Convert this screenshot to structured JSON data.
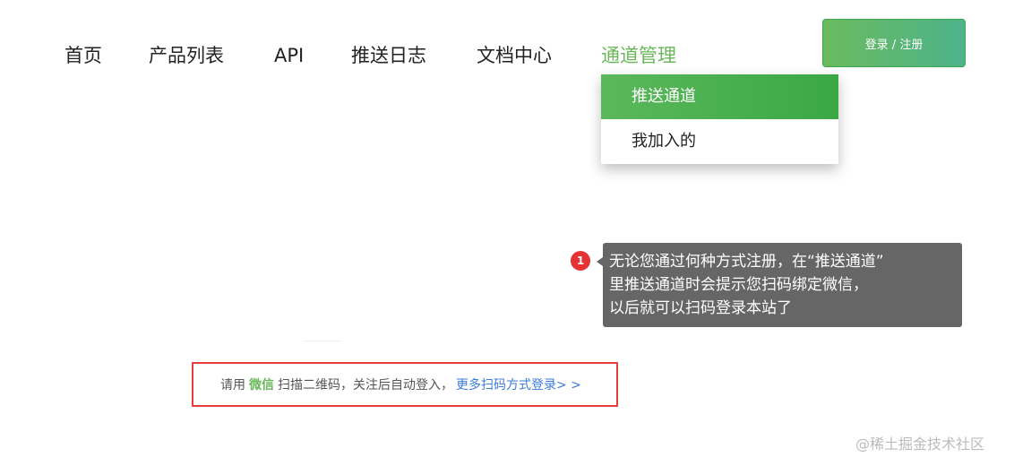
{
  "nav": {
    "items": [
      {
        "label": "首页"
      },
      {
        "label": "产品列表"
      },
      {
        "label": "API"
      },
      {
        "label": "推送日志"
      },
      {
        "label": "文档中心"
      },
      {
        "label": "通道管理"
      }
    ],
    "login_label": "登录 / 注册"
  },
  "dropdown": {
    "items": [
      {
        "label": "推送通道"
      },
      {
        "label": "我加入的"
      }
    ]
  },
  "tooltip": {
    "badge": "1",
    "lines": [
      "无论您通过何种方式注册，在“推送通道”",
      "里推送通道时会提示您扫码绑定微信，",
      "以后就可以扫码登录本站了"
    ]
  },
  "login_hint": {
    "prefix": "请用",
    "wechat": "微信",
    "suffix": "扫描二维码，关注后自动登入，",
    "more_link": "更多扫码方式登录> >"
  },
  "watermark": "@稀土掘金技术社区",
  "colors": {
    "accent": "#6ab65a",
    "highlight_box": "#e53e3e",
    "link": "#3b7dd8",
    "tooltip_bg": "#666666"
  }
}
